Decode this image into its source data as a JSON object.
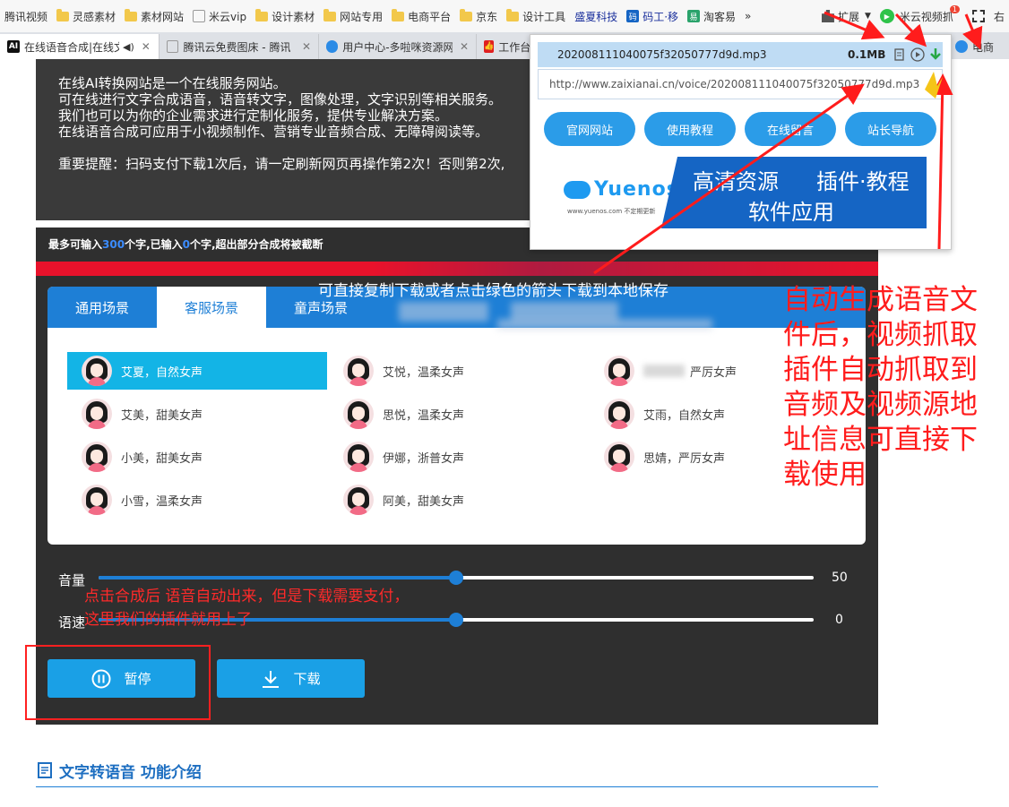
{
  "bookmarks": {
    "items": [
      {
        "label": "腾讯视频",
        "type": "text"
      },
      {
        "label": "灵感素材",
        "type": "folder"
      },
      {
        "label": "素材网站",
        "type": "folder"
      },
      {
        "label": "米云vip",
        "type": "page"
      },
      {
        "label": "设计素材",
        "type": "folder"
      },
      {
        "label": "网站专用",
        "type": "folder"
      },
      {
        "label": "电商平台",
        "type": "folder"
      },
      {
        "label": "京东",
        "type": "folder"
      },
      {
        "label": "设计工具",
        "type": "folder"
      },
      {
        "label": "盛夏科技",
        "type": "link"
      },
      {
        "label": "码工·移",
        "type": "link"
      },
      {
        "label": "淘客易",
        "type": "link"
      }
    ],
    "more": "»",
    "extensions_label": "扩展",
    "video_grab_label": "米云视频抓",
    "badge": "1",
    "right_label": "右"
  },
  "tabs": [
    {
      "label": "在线语音合成|在线文",
      "active": true,
      "icon": "AI"
    },
    {
      "label": "腾讯云免费图床 - 腾讯",
      "active": false,
      "icon": "page"
    },
    {
      "label": "用户中心-多啦咪资源网",
      "active": false,
      "icon": "cloud"
    },
    {
      "label": "工作台",
      "active": false,
      "icon": "thumb"
    },
    {
      "label": "电商",
      "active": false,
      "icon": "cloud"
    }
  ],
  "intro": {
    "line1": "在线AI转换网站是一个在线服务网站。",
    "line2": "可在线进行文字合成语音，语音转文字，图像处理，文字识别等相关服务。",
    "line3": "我们也可以为你的企业需求进行定制化服务，提供专业解决方案。",
    "line4": "在线语音合成可应用于小视频制作、营销专业音频合成、无障碍阅读等。",
    "notice": "重要提醒：扫码支付下载1次后，请一定刷新网页再操作第2次！否则第2次,"
  },
  "counter": {
    "prefix": "最多可输入",
    "max": "300",
    "mid": "个字,已输入",
    "current": "0",
    "suffix": "个字,超出部分合成将被截断"
  },
  "scene_tabs": [
    {
      "label": "通用场景",
      "active": false
    },
    {
      "label": "客服场景",
      "active": true
    },
    {
      "label": "童声场景",
      "active": false
    }
  ],
  "voices": [
    {
      "label": "艾夏，自然女声",
      "selected": true
    },
    {
      "label": "艾悦，温柔女声",
      "selected": false
    },
    {
      "label": "严厉女声",
      "selected": false
    },
    {
      "label": "艾美，甜美女声",
      "selected": false
    },
    {
      "label": "思悦，温柔女声",
      "selected": false
    },
    {
      "label": "艾雨，自然女声",
      "selected": false
    },
    {
      "label": "小美，甜美女声",
      "selected": false
    },
    {
      "label": "伊娜，浙普女声",
      "selected": false
    },
    {
      "label": "思婧，严厉女声",
      "selected": false
    },
    {
      "label": "小雪，温柔女声",
      "selected": false
    },
    {
      "label": "阿美，甜美女声",
      "selected": false
    }
  ],
  "controls": {
    "volume_label": "音量",
    "volume_value": "50",
    "volume_fraction": 0.5,
    "speed_label": "语速",
    "speed_value": "0",
    "speed_fraction": 0.5,
    "pause_label": "暂停",
    "download_label": "下载"
  },
  "feature_title": "文字转语音 功能介绍",
  "popup": {
    "filename": "202008111040075f32050777d9d.mp3",
    "size": "0.1MB",
    "url": "http://www.zaixianai.cn/voice/202008111040075f32050777d9d.mp3",
    "buttons": [
      "官网网站",
      "使用教程",
      "在线留言",
      "站长导航"
    ],
    "banner_logo": "Yuenos",
    "banner_site": "www.yuenos.com 不定期更新",
    "banner_line1a": "高清资源",
    "banner_line1b": "插件·教程",
    "banner_line2": "软件应用"
  },
  "annotations": {
    "big": "自动生成语音文件后，视频抓取插件自动抓取到音频及视频源地址信息可直接下载使用",
    "mid": "可直接复制下载或者点击绿色的箭头下载到本地保存",
    "small_line1": "点击合成后 语音自动出来，但是下载需要支付，",
    "small_line2": "这里我们的插件就用上了"
  },
  "colors": {
    "accent": "#1e7fd6",
    "button": "#1aa0e6",
    "annotation": "#ff1c1c",
    "dark_panel": "#2f2f2f",
    "selected_voice": "#13b4e6"
  }
}
